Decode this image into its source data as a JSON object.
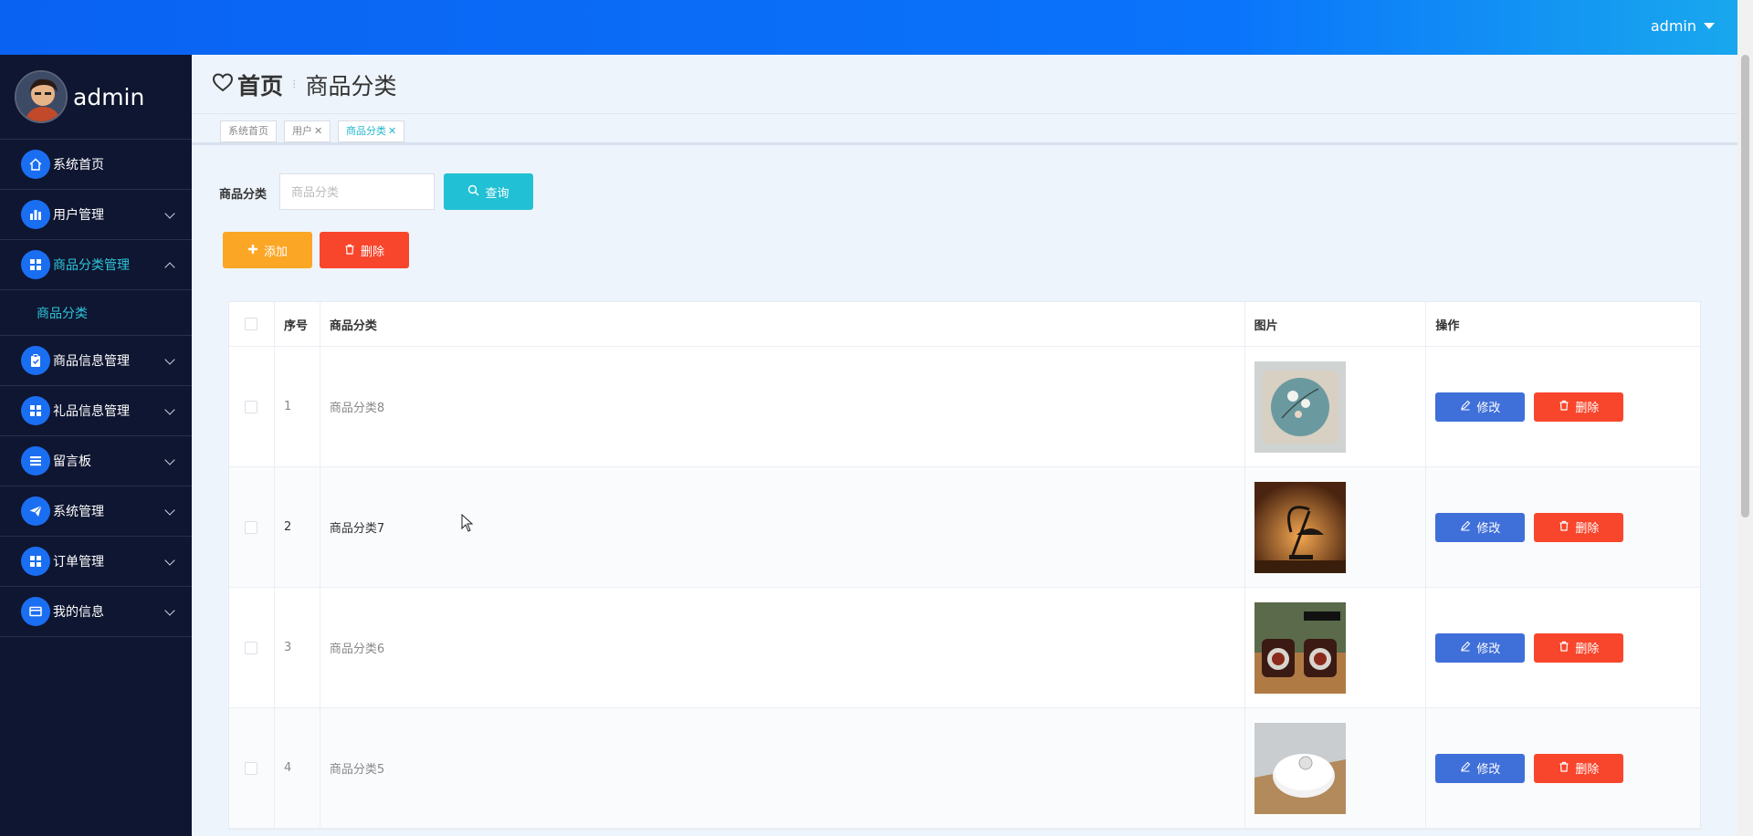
{
  "topbar": {
    "user_label": "admin"
  },
  "sidebar": {
    "profile_name": "admin",
    "items": [
      {
        "label": "系统首页",
        "icon": "home-icon"
      },
      {
        "label": "用户管理",
        "icon": "bar-chart-icon"
      },
      {
        "label": "商品分类管理",
        "icon": "grid-icon"
      },
      {
        "label": "商品信息管理",
        "icon": "clipboard-icon"
      },
      {
        "label": "礼品信息管理",
        "icon": "grid-icon"
      },
      {
        "label": "留言板",
        "icon": "list-icon"
      },
      {
        "label": "系统管理",
        "icon": "paper-plane-icon"
      },
      {
        "label": "订单管理",
        "icon": "grid-icon"
      },
      {
        "label": "我的信息",
        "icon": "card-icon"
      }
    ],
    "sub_item": "商品分类"
  },
  "header": {
    "home": "首页",
    "current": "商品分类"
  },
  "tags": [
    {
      "label": "系统首页"
    },
    {
      "label": "用户"
    },
    {
      "label": "商品分类"
    }
  ],
  "search": {
    "label": "商品分类",
    "placeholder": "商品分类",
    "button": "查询"
  },
  "actions": {
    "add": "添加",
    "delete": "删除"
  },
  "table": {
    "headers": {
      "index": "序号",
      "name": "商品分类",
      "image": "图片",
      "ops": "操作"
    },
    "rows": [
      {
        "index": "1",
        "name": "商品分类8",
        "image": "pillow-image"
      },
      {
        "index": "2",
        "name": "商品分类7",
        "image": "lamp-image"
      },
      {
        "index": "3",
        "name": "商品分类6",
        "image": "speakers-image"
      },
      {
        "index": "4",
        "name": "商品分类5",
        "image": "robot-vacuum-image"
      }
    ],
    "edit_label": "修改",
    "delete_label": "删除"
  },
  "colors": {
    "accent": "#22c0d4",
    "primary": "#0a62f2",
    "sidebar": "#0f1631",
    "warning": "#fca625",
    "danger": "#f8462c",
    "edit": "#3f6fd8"
  }
}
